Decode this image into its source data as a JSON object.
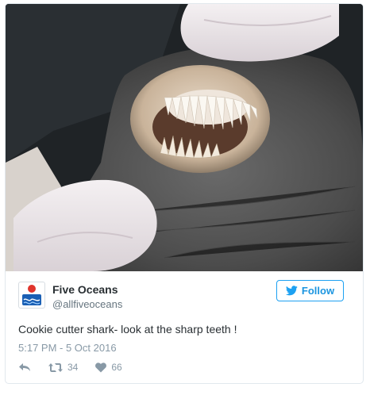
{
  "author": {
    "name": "Five Oceans",
    "handle": "@allfiveoceans",
    "avatar_icon": "five-oceans-logo"
  },
  "follow_button": {
    "label": "Follow",
    "icon": "twitter-bird-icon",
    "color": "#1da1f2"
  },
  "tweet": {
    "text": "Cookie cutter shark- look at the sharp teeth !",
    "timestamp": "5:17 PM - 5 Oct 2016",
    "media": {
      "subject": "photo of cookie cutter shark mouth showing sharp teeth"
    }
  },
  "actions": {
    "reply_icon": "reply-icon",
    "retweet_icon": "retweet-icon",
    "retweet_count": "34",
    "like_icon": "heart-icon",
    "like_count": "66"
  }
}
